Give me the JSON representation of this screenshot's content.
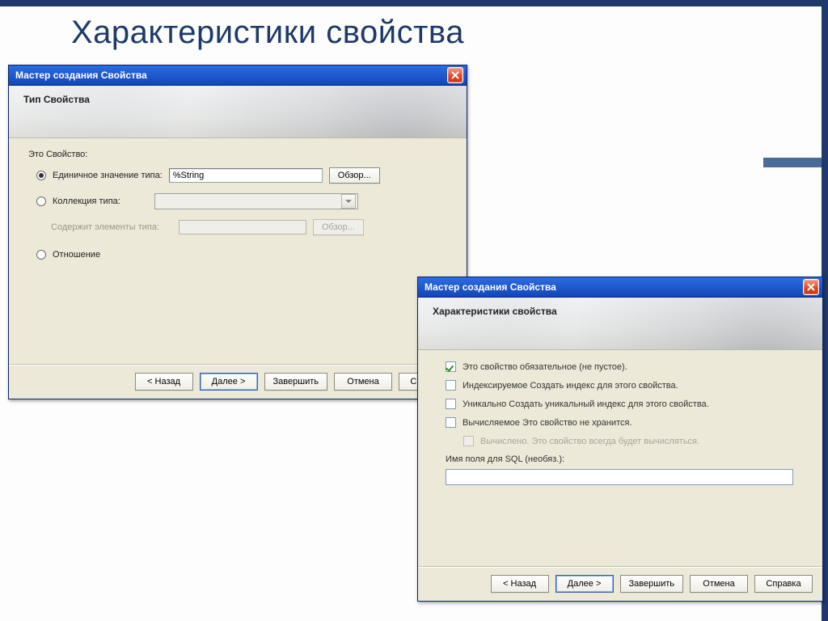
{
  "slide": {
    "title": "Характеристики свойства"
  },
  "buttons": {
    "back": "< Назад",
    "next": "Далее >",
    "finish": "Завершить",
    "cancel": "Отмена",
    "help": "Справка"
  },
  "window1": {
    "title": "Мастер создания Свойства",
    "heading": "Тип Свойства",
    "section_label": "Это Свойство:",
    "browse_label": "Обзор...",
    "options": {
      "single": {
        "label": "Единичное значение типа:",
        "value": "%String"
      },
      "collection": {
        "label": "Коллекция типа:",
        "elements_label": "Содержит элементы типа:"
      },
      "relationship": {
        "label": "Отношение"
      }
    }
  },
  "window2": {
    "title": "Мастер создания Свойства",
    "heading": "Характеристики свойства",
    "checks": {
      "required": "Это свойство обязательное (не пустое).",
      "indexed": "Индексируемое   Создать индекс для этого свойства.",
      "unique": "Уникально   Создать уникальный индекс для этого свойства.",
      "computed": "Вычисляемое Это свойство не хранится.",
      "calculated": "Вычислено. Это свойство всегда будет вычисляться."
    },
    "sql_label": "Имя поля для SQL (необяз.):"
  }
}
